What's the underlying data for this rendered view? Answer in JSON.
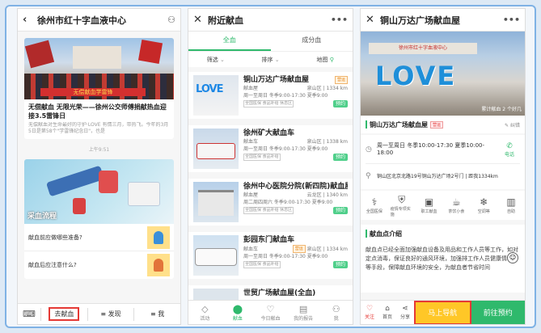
{
  "panel1": {
    "title": "徐州市红十字血液中心",
    "banner_text": "无偿献血 无限光荣",
    "banner_sign": "无偿献血学雷锋",
    "article_title": "无偿献血 无限光荣——徐州公交师傅捐献热血迎接3.5雷锋日",
    "article_desc": "无偿献血对生命最好的守护·LOVE 有情三月，带热飞。今年的3月5日是第58个\"学雷锋纪念日\"，也是",
    "time_label": "上午9:51",
    "illus_title": "采血流程",
    "faq": [
      {
        "q": "献血前应做哪些准备?"
      },
      {
        "q": "献血后应注意什么?"
      }
    ],
    "tabs": {
      "donate": "去献血",
      "discover": "≡ 发现",
      "me": "≡ 我"
    }
  },
  "panel2": {
    "title": "附近献血",
    "tab_all": "全血",
    "tab_component": "成分血",
    "filter": "筛选",
    "sort": "排序",
    "map": "地图",
    "items": [
      {
        "name": "铜山万达广场献血屋",
        "type": "献血屋",
        "status": "营运",
        "area": "泉山区",
        "dist": "1334 km",
        "hours": "周一至周日 冬季9:00-17:30 夏季9:00",
        "tags": "全国医保 食品补给 休息区",
        "btn": "预约"
      },
      {
        "name": "徐州矿大献血车",
        "type": "献血车",
        "status": "",
        "area": "泉山区",
        "dist": "1338 km",
        "hours": "周一至周日 冬季9:00-17:30 夏季9:00",
        "tags": "全国医保 食品补给",
        "btn": "预约"
      },
      {
        "name": "徐州中心医院分院(新四院)献血屋",
        "type": "献血屋",
        "status": "",
        "area": "云龙区",
        "dist": "1340 km",
        "hours": "周二周四周六 冬季9:00-17:30 夏季9:00",
        "tags": "全国医保 食品补给 休息区",
        "btn": "预约"
      },
      {
        "name": "彭园东门献血车",
        "type": "献血车",
        "status": "营运",
        "area": "泉山区",
        "dist": "1334 km",
        "hours": "周一至周日 冬季9:00-17:30 夏季9:00",
        "tags": "全国医保 食品补给",
        "btn": "预约"
      },
      {
        "name": "世贸广场献血屋(全血)",
        "type": "",
        "status": "",
        "area": "",
        "dist": "",
        "hours": "",
        "tags": "",
        "btn": ""
      }
    ],
    "tabs": [
      "活动",
      "献血",
      "今日献血",
      "我的报告",
      "我"
    ]
  },
  "panel3": {
    "title": "铜山万达广场献血屋",
    "photo_word": "LOVE",
    "photo_sign": "徐州市红十字血液中心",
    "photo_caption": "累计献血 2 个好几",
    "name": "铜山万达广场献血屋",
    "badge": "营运",
    "report": "纠错",
    "hours": "周一至周日 冬季10:00-17:30 夏季10:00-18:00",
    "phone": "电话",
    "address": "铜山区北京北路19号铜山万达广场2号门 | 距我1334km",
    "services": [
      "全国医保",
      "疫情专项实施",
      "职工献血",
      "茶饮小食",
      "空调等",
      "自助"
    ],
    "section_title": "献血点介绍",
    "intro": "献血点已经全面加强献血设备及用品和工作人员等工作，如对定点消毒，保证良好的通风环境，加强排工作人员健康情况等等手段，保障献血环境的安全，为献血者节省时间",
    "actions": {
      "collect": "关注",
      "home": "首页",
      "share": "分享"
    },
    "navigate": "马上导航",
    "book": "前往预约"
  },
  "colors": {
    "accent": "#2fb96c",
    "highlight": "#e53935",
    "nav_btn": "#ffc727"
  }
}
